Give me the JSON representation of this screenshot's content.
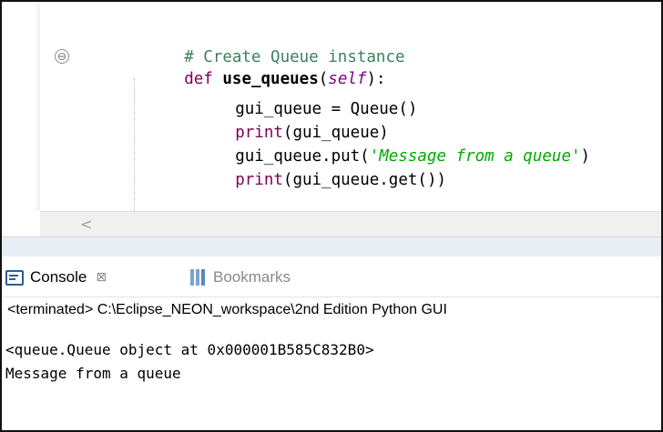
{
  "editor": {
    "lines": {
      "comment": "# Create Queue instance",
      "def_kw": "def",
      "func_name": "use_queues",
      "paren_open": "(",
      "self_kw": "self",
      "paren_close_colon": "):",
      "line3": "gui_queue = Queue()",
      "print_kw": "print",
      "line4_rest": "(gui_queue)",
      "line5_a": "gui_queue.put(",
      "line5_str": "'Message from a queue'",
      "line5_b": ")",
      "line6_rest": "(gui_queue.get())"
    },
    "fold_glyph": "⊖",
    "scroll_left_glyph": "<"
  },
  "console": {
    "tabs": [
      {
        "label": "Console",
        "close_glyph": "⊠",
        "icon": "console-icon"
      },
      {
        "label": "Bookmarks",
        "icon": "bookmarks-icon"
      }
    ],
    "status": "<terminated> C:\\Eclipse_NEON_workspace\\2nd Edition Python GUI",
    "output": [
      "<queue.Queue object at 0x000001B585C832B0>",
      "Message from a queue"
    ]
  }
}
